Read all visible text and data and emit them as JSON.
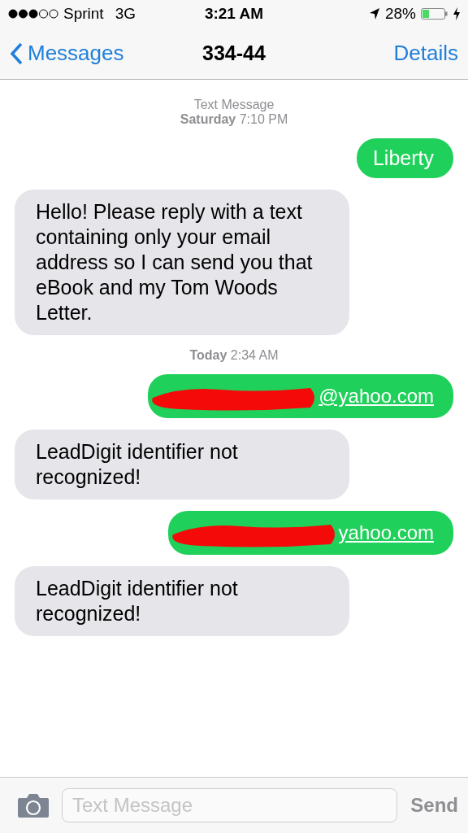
{
  "status_bar": {
    "carrier": "Sprint",
    "network": "3G",
    "time": "3:21 AM",
    "battery": "28%"
  },
  "nav": {
    "back": "Messages",
    "title": "334-44",
    "action": "Details"
  },
  "messages": [
    {
      "kind": "timestamp",
      "lines": [
        "Text Message",
        "**Saturday** 7:10 PM"
      ]
    },
    {
      "kind": "sent",
      "text": "Liberty",
      "redacted": false
    },
    {
      "kind": "received",
      "text": "Hello! Please reply with a text containing only your email address so I can send you that eBook and my Tom Woods Letter.",
      "redacted": false
    },
    {
      "kind": "timestamp",
      "lines": [
        "**Today** 2:34 AM"
      ]
    },
    {
      "kind": "sent",
      "text": "@yahoo.com",
      "redacted": true
    },
    {
      "kind": "received",
      "text": "LeadDigit identifier not recognized!",
      "redacted": false
    },
    {
      "kind": "sent",
      "text": "yahoo.com",
      "redacted": true
    },
    {
      "kind": "received",
      "text": "LeadDigit identifier not recognized!",
      "redacted": false
    }
  ],
  "compose": {
    "placeholder": "Text Message",
    "send": "Send"
  }
}
